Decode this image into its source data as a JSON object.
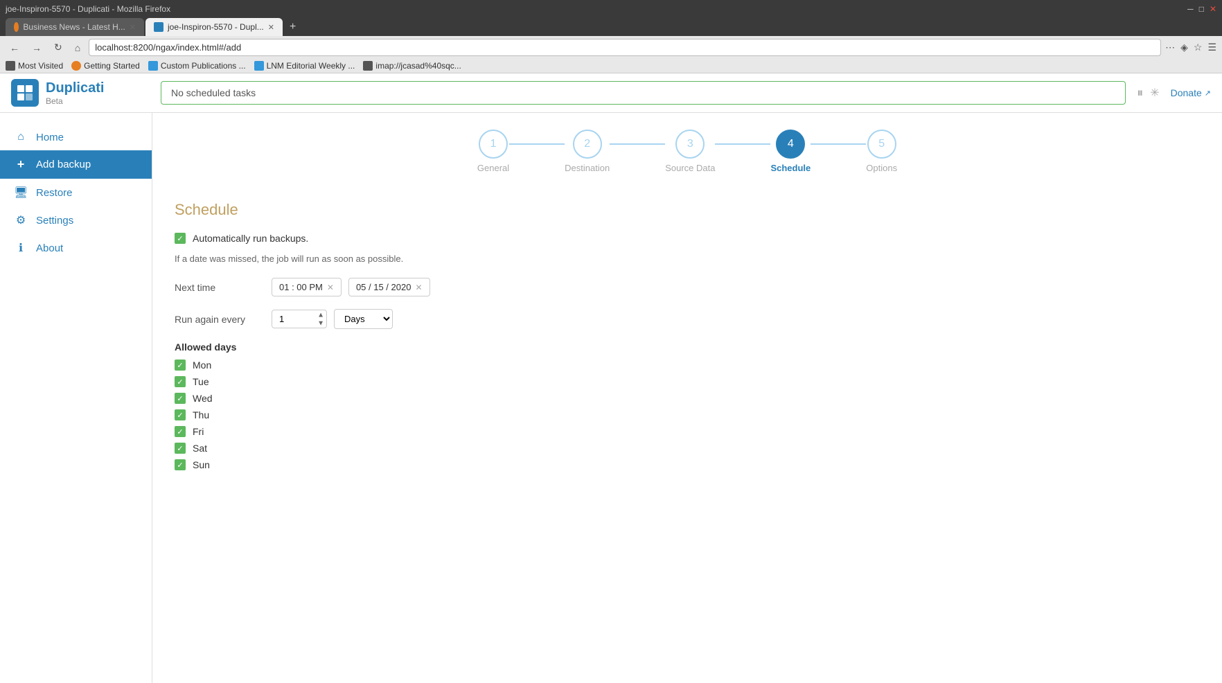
{
  "browser": {
    "title": "joe-Inspiron-5570 - Duplicati - Mozilla Firefox",
    "tab1_label": "Business News - Latest H...",
    "tab2_label": "joe-Inspiron-5570 - Dupl...",
    "address": "localhost:8200/ngax/index.html#/add",
    "bookmark1": "Most Visited",
    "bookmark2": "Getting Started",
    "bookmark3": "Custom Publications ...",
    "bookmark4": "LNM Editorial Weekly ...",
    "bookmark5": "imap://jcasad%40sqc..."
  },
  "header": {
    "logo_text": "Duplicati",
    "logo_beta": "Beta",
    "message": "No scheduled tasks",
    "donate_label": "Donate"
  },
  "sidebar": {
    "items": [
      {
        "id": "home",
        "label": "Home",
        "icon": "⌂"
      },
      {
        "id": "add-backup",
        "label": "Add backup",
        "icon": "+"
      },
      {
        "id": "restore",
        "label": "Restore",
        "icon": "🖥"
      },
      {
        "id": "settings",
        "label": "Settings",
        "icon": "⚙"
      },
      {
        "id": "about",
        "label": "About",
        "icon": "ℹ"
      }
    ]
  },
  "wizard": {
    "steps": [
      {
        "num": "1",
        "label": "General",
        "active": false
      },
      {
        "num": "2",
        "label": "Destination",
        "active": false
      },
      {
        "num": "3",
        "label": "Source Data",
        "active": false
      },
      {
        "num": "4",
        "label": "Schedule",
        "active": true
      },
      {
        "num": "5",
        "label": "Options",
        "active": false
      }
    ]
  },
  "schedule": {
    "title": "Schedule",
    "auto_run_label": "Automatically run backups.",
    "hint_text": "If a date was missed, the job will run as soon as possible.",
    "next_time_label": "Next time",
    "time_value": "01 : 00  PM",
    "date_value": "05 / 15 / 2020",
    "run_again_label": "Run again every",
    "run_again_num": "1",
    "run_again_unit": "Days",
    "allowed_days_label": "Allowed days",
    "days": [
      {
        "key": "mon",
        "label": "Mon",
        "checked": true
      },
      {
        "key": "tue",
        "label": "Tue",
        "checked": true
      },
      {
        "key": "wed",
        "label": "Wed",
        "checked": true
      },
      {
        "key": "thu",
        "label": "Thu",
        "checked": true
      },
      {
        "key": "fri",
        "label": "Fri",
        "checked": true
      },
      {
        "key": "sat",
        "label": "Sat",
        "checked": true
      },
      {
        "key": "sun",
        "label": "Sun",
        "checked": true
      }
    ]
  }
}
